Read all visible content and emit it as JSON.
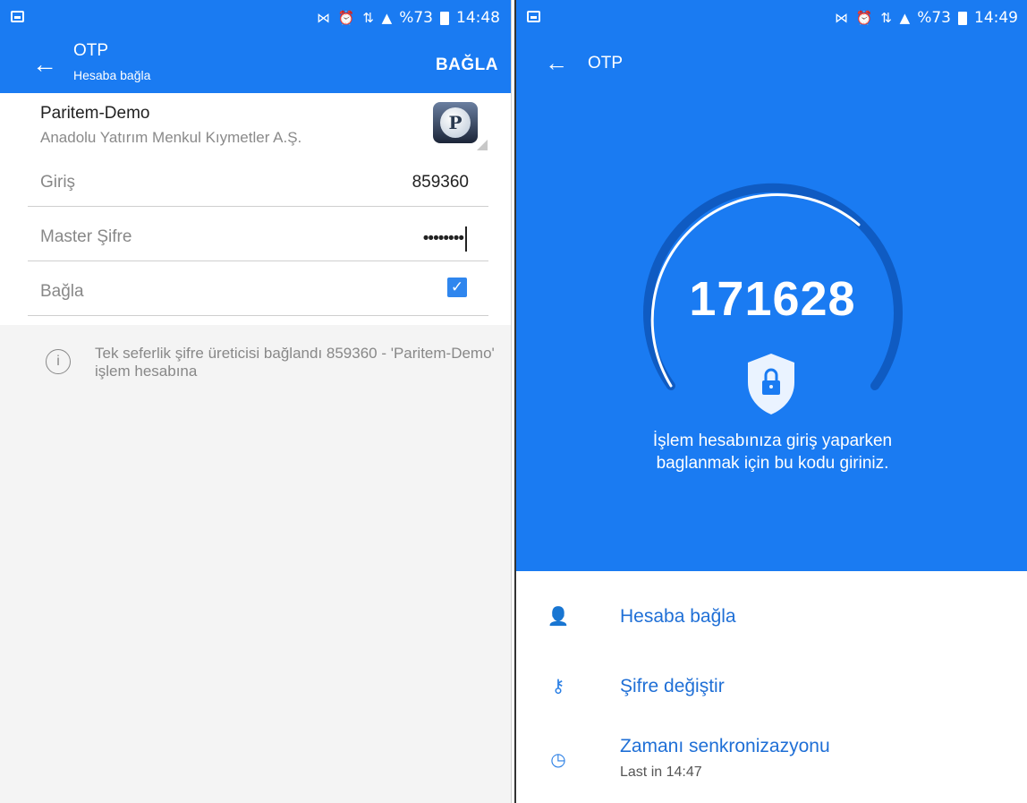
{
  "status_left": {
    "glyphs": "⋈ ⏰ ⇅ ▲",
    "battery_pct": "%73",
    "time": "14:48"
  },
  "status_right": {
    "glyphs": "⋈ ⏰ ⇅ ▲",
    "battery_pct": "%73",
    "time": "14:49"
  },
  "left": {
    "appbar": {
      "title": "OTP",
      "subtitle": "Hesaba bağla",
      "action": "BAĞLA"
    },
    "account": {
      "name": "Paritem-Demo",
      "org": "Anadolu Yatırım Menkul Kıymetler A.Ş.",
      "logo_letter": "P"
    },
    "fields": {
      "login_label": "Giriş",
      "login_value": "859360",
      "master_label": "Master Şifre",
      "master_value": "••••••••",
      "connect_label": "Bağla",
      "connect_checked": true
    },
    "info_text": "Tek seferlik şifre üreticisi bağlandı 859360 - 'Paritem-Demo' işlem hesabına"
  },
  "right": {
    "title": "OTP",
    "code": "171628",
    "description_line1": "İşlem hesabınıza giriş yaparken",
    "description_line2": "baglanmak için bu kodu giriniz.",
    "menu": [
      {
        "label": "Hesaba bağla",
        "icon": "user-check-icon"
      },
      {
        "label": "Şifre değiştir",
        "icon": "key-change-icon"
      },
      {
        "label": "Zamanı senkronizazyonu",
        "sub": "Last in 14:47",
        "icon": "clock-sync-icon"
      }
    ]
  },
  "colors": {
    "primary": "#1a7bf2",
    "link": "#1f6fd6",
    "muted": "#888888"
  }
}
